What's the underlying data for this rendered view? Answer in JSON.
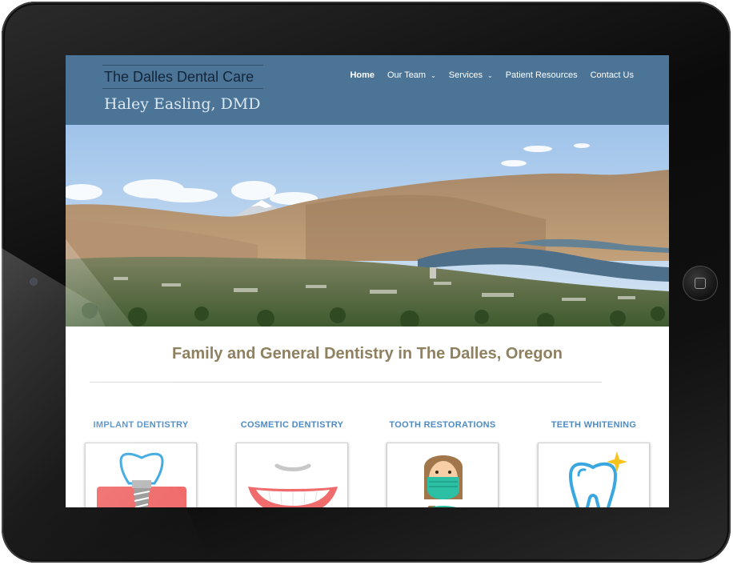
{
  "site": {
    "title": "The Dalles Dental Care",
    "subtitle": "Haley Easling, DMD"
  },
  "nav": {
    "items": [
      {
        "label": "Home",
        "active": true,
        "has_dropdown": false
      },
      {
        "label": "Our Team",
        "active": false,
        "has_dropdown": true
      },
      {
        "label": "Services",
        "active": false,
        "has_dropdown": true
      },
      {
        "label": "Patient Resources",
        "active": false,
        "has_dropdown": false
      },
      {
        "label": "Contact Us",
        "active": false,
        "has_dropdown": false
      }
    ]
  },
  "intro": {
    "heading": "Family and General Dentistry in The Dalles, Oregon"
  },
  "services": [
    {
      "label": "IMPLANT DENTISTRY",
      "icon": "dental-implant-icon"
    },
    {
      "label": "COSMETIC DENTISTRY",
      "icon": "smile-icon"
    },
    {
      "label": "TOOTH RESTORATIONS",
      "icon": "dentist-icon"
    },
    {
      "label": "TEETH WHITENING",
      "icon": "sparkling-tooth-icon"
    }
  ],
  "colors": {
    "header_bg": "#4b7496",
    "heading_text": "#8f8060",
    "service_label": "#4d8bc4"
  }
}
